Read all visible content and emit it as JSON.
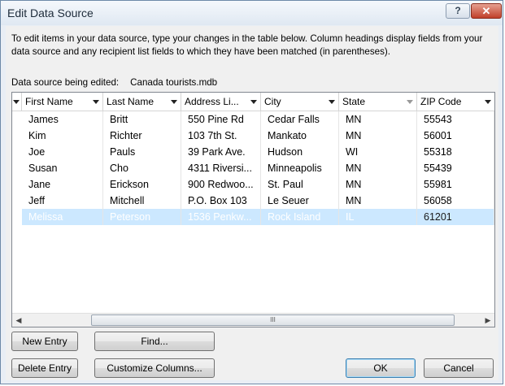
{
  "window": {
    "title": "Edit Data Source",
    "help_glyph": "?",
    "close_glyph": "✕"
  },
  "instructions": "To edit items in your data source, type your changes in the table below. Column headings display fields from your data source and any recipient list fields to which they have been matched (in parentheses).",
  "source": {
    "label": "Data source being edited:",
    "file": "Canada tourists.mdb"
  },
  "table": {
    "columns": [
      "First Name",
      "Last Name",
      "Address Li...",
      "City",
      "State",
      "ZIP Code"
    ],
    "rows": [
      [
        "James",
        "Britt",
        "550 Pine Rd",
        "Cedar Falls",
        "MN",
        "55543"
      ],
      [
        "Kim",
        "Richter",
        "103 7th St.",
        "Mankato",
        "MN",
        "56001"
      ],
      [
        "Joe",
        "Pauls",
        "39 Park Ave.",
        "Hudson",
        "WI",
        "55318"
      ],
      [
        "Susan",
        "Cho",
        "4311 Riversi...",
        "Minneapolis",
        "MN",
        "55439"
      ],
      [
        "Jane",
        "Erickson",
        "900 Redwoo...",
        "St. Paul",
        "MN",
        "55981"
      ],
      [
        "Jeff",
        "Mitchell",
        "P.O. Box 103",
        "Le Seuer",
        "MN",
        "56058"
      ],
      [
        "Melissa",
        "Peterson",
        "1536 Penkw...",
        "Rock Island",
        "IL",
        "61201"
      ]
    ],
    "selected_row": 6,
    "scroll_grip": "III",
    "scroll_left": "◀",
    "scroll_right": "▶"
  },
  "buttons": {
    "new_entry": "New Entry",
    "find": "Find...",
    "delete_entry": "Delete Entry",
    "customize": "Customize Columns...",
    "ok": "OK",
    "cancel": "Cancel"
  },
  "colors": {
    "selection": "#cce8ff",
    "close_button": "#c0402a"
  }
}
